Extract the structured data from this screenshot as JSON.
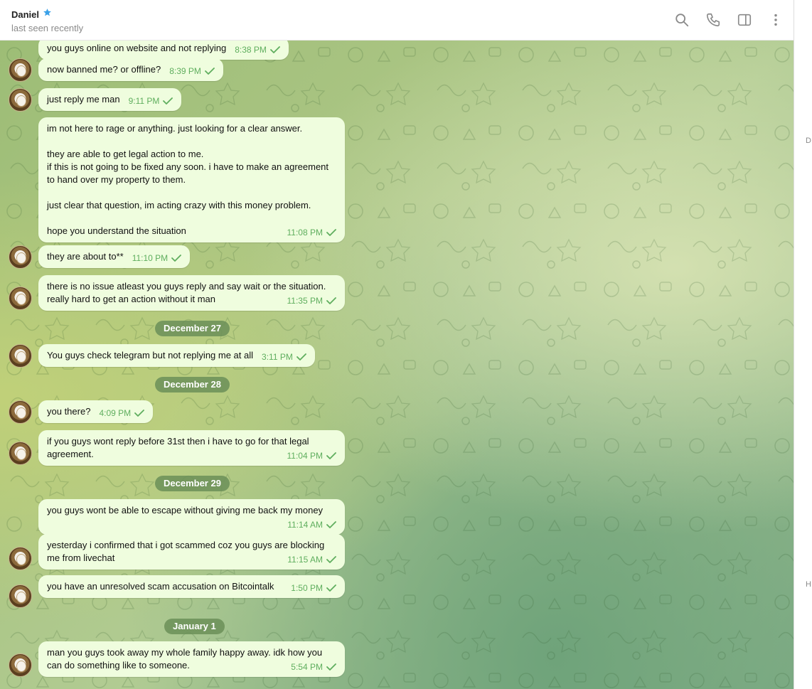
{
  "header": {
    "contact_name": "Daniel",
    "status": "last seen recently",
    "icons": [
      "star-icon",
      "search-icon",
      "phone-icon",
      "sidebar-toggle-icon",
      "more-vert-icon"
    ]
  },
  "colors": {
    "bubble_bg": "#effdde",
    "meta_green": "#5fae5e",
    "date_pill_bg": "#6b8f58",
    "star_blue": "#3ba1e8"
  },
  "messages": [
    {
      "text": "you guys online on website and not replying",
      "time": "8:38 PM"
    },
    {
      "text": "now banned me? or offline?",
      "time": "8:39 PM"
    },
    {
      "text": "just reply me man",
      "time": "9:11 PM"
    },
    {
      "text": "im not here to rage or anything. just looking for a clear answer.\n\nthey are able to get legal action to me.\nif this is not going to be fixed any soon. i have to make an agreement\nto hand over my property to them.\n\njust clear that question, im acting crazy with this money problem.\n\nhope you understand the situation",
      "time": "11:08 PM"
    },
    {
      "text": "they are about to**",
      "time": "11:10 PM"
    },
    {
      "text": "there is no issue atleast you guys reply and say wait or the situation.\nreally hard to get an action without it man",
      "time": "11:35 PM"
    },
    {
      "text": "You guys check telegram but not replying me at all",
      "time": "3:11 PM"
    },
    {
      "text": "you there?",
      "time": "4:09 PM"
    },
    {
      "text": "if you guys wont reply before 31st then i have to go for that legal\nagreement.",
      "time": "11:04 PM"
    },
    {
      "text": "you guys wont be able to escape without giving me back my money",
      "time": "11:14 AM"
    },
    {
      "text": "yesterday i confirmed that i got scammed coz you guys are blocking\nme from livechat",
      "time": "11:15 AM"
    },
    {
      "text": "you have an unresolved scam accusation on Bitcointalk",
      "time": "1:50 PM"
    },
    {
      "text": "man you guys took away my whole family happy away. idk how you\ncan do something like to someone.",
      "time": "5:54 PM"
    }
  ],
  "dates": [
    "December 27",
    "December 28",
    "December 29",
    "January 1"
  ],
  "right_fragments": [
    "D",
    "H"
  ]
}
